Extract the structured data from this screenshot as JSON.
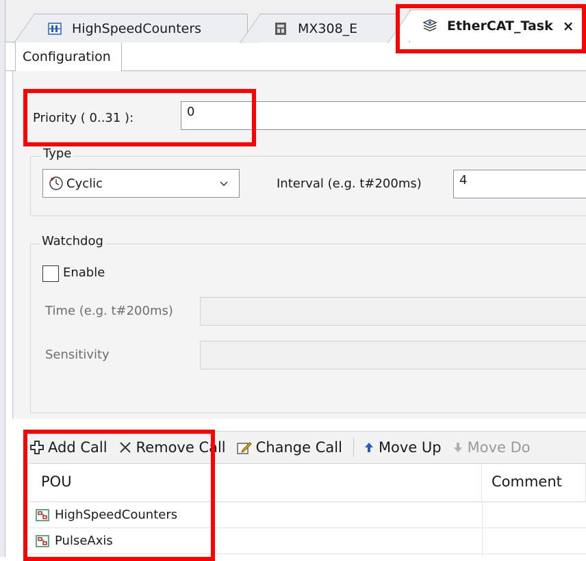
{
  "tabs": [
    {
      "label": "HighSpeedCounters",
      "icon": "counter-icon"
    },
    {
      "label": "MX308_E",
      "icon": "device-icon"
    },
    {
      "label": "EtherCAT_Task",
      "icon": "task-stack-icon",
      "active": true,
      "close": "×"
    }
  ],
  "subtab": {
    "label": "Configuration"
  },
  "priority": {
    "label": "Priority ( 0..31  ):",
    "value": "0"
  },
  "type_group": {
    "title": "Type",
    "selected": "Cyclic",
    "interval_label": "Interval (e.g. t#200ms)",
    "interval_value": "4"
  },
  "watchdog": {
    "title": "Watchdog",
    "enable_label": "Enable",
    "enabled": false,
    "time_label": "Time (e.g. t#200ms)",
    "sensitivity_label": "Sensitivity"
  },
  "toolbar": {
    "add_call": "Add Call",
    "remove_call": "Remove Call",
    "change_call": "Change Call",
    "move_up": "Move Up",
    "move_down": "Move Do"
  },
  "table": {
    "columns": [
      "POU",
      "Comment"
    ],
    "rows": [
      {
        "pou": "HighSpeedCounters",
        "comment": ""
      },
      {
        "pou": "PulseAxis",
        "comment": ""
      }
    ]
  },
  "colors": {
    "highlight": "#ff0000",
    "accent": "#1f5fbf"
  }
}
